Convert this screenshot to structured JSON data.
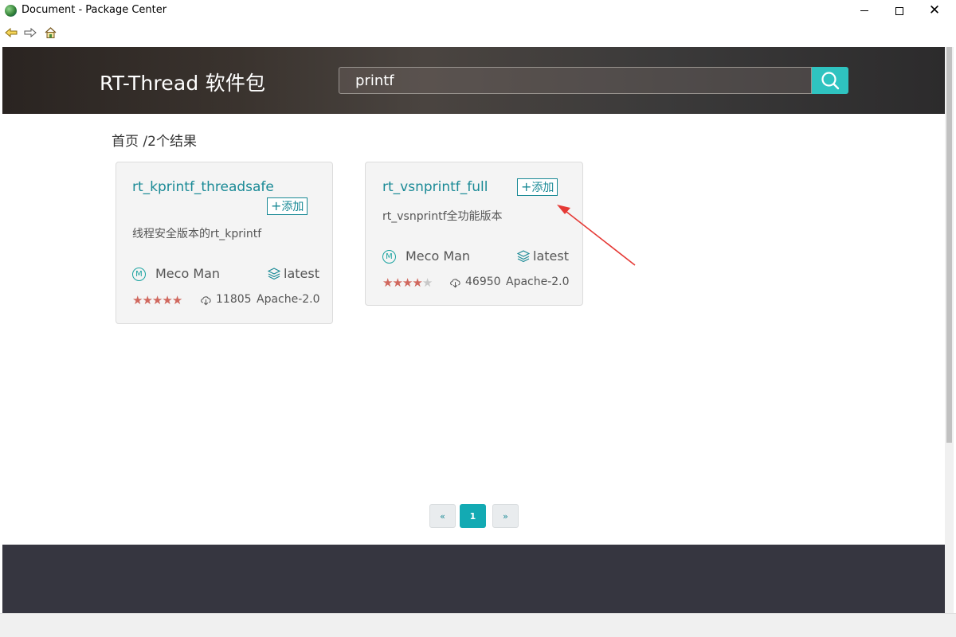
{
  "window": {
    "title": "Document - Package Center"
  },
  "header": {
    "brand": "RT-Thread 软件包",
    "search": {
      "value": "printf"
    }
  },
  "breadcrumb": "首页 /2个结果",
  "packages": [
    {
      "name": "rt_kprintf_threadsafe",
      "add_label": "添加",
      "description": "线程安全版本的rt_kprintf",
      "author": "Meco Man",
      "author_initial": "M",
      "version": "latest",
      "rating": 5,
      "rating_max": 5,
      "downloads": "11805",
      "license": "Apache-2.0"
    },
    {
      "name": "rt_vsnprintf_full",
      "add_label": "添加",
      "description": "rt_vsnprintf全功能版本",
      "author": "Meco Man",
      "author_initial": "M",
      "version": "latest",
      "rating": 4,
      "rating_max": 5,
      "downloads": "46950",
      "license": "Apache-2.0"
    }
  ],
  "pagination": {
    "prev": "«",
    "current": "1",
    "next": "»"
  },
  "colors": {
    "accent": "#1a8a96",
    "search_button": "#2fc3c0",
    "star": "#d0675d",
    "footer": "#363640"
  }
}
